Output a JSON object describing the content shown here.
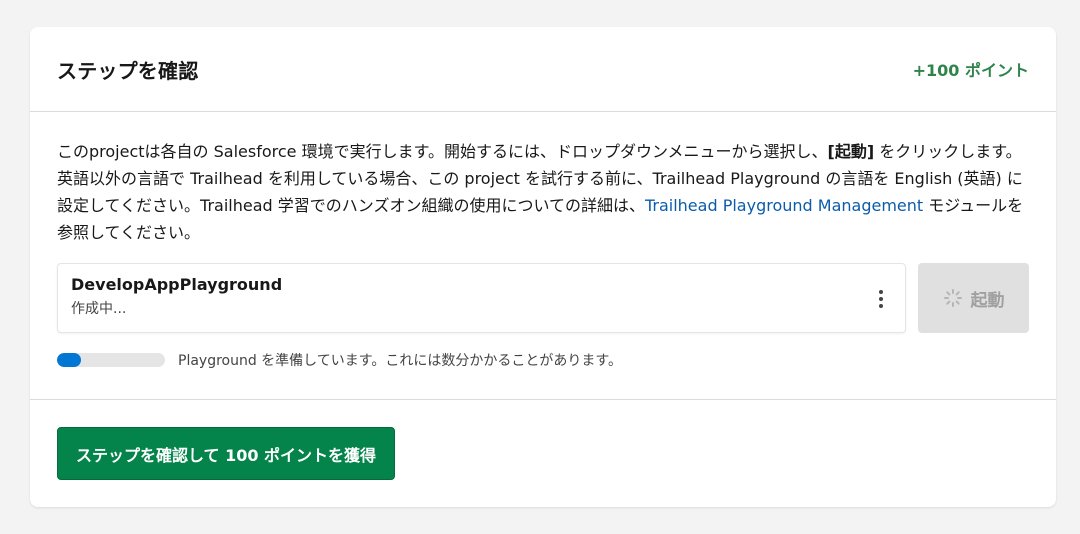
{
  "header": {
    "title": "ステップを確認",
    "points": "+100 ポイント"
  },
  "description": {
    "part1": "このprojectは各自の Salesforce 環境で実行します。開始するには、ドロップダウンメニューから選択し、",
    "bold": "[起動]",
    "part2": " をクリックします。英語以外の言語で Trailhead を利用している場合、この project を試行する前に、Trailhead Playground の言語を English (英語) に設定してください。Trailhead 学習でのハンズオン組織の使用についての詳細は、",
    "link": "Trailhead Playground Management",
    "part3": " モジュールを参照してください。"
  },
  "org": {
    "name": "DevelopAppPlayground",
    "status": "作成中..."
  },
  "launch_button": {
    "label": "起動"
  },
  "progress": {
    "fraction": 0.22,
    "text": "Playground を準備しています。これには数分かかることがあります。"
  },
  "footer": {
    "verify_label": "ステップを確認して 100 ポイントを獲得"
  },
  "colors": {
    "brand_green": "#04844b",
    "points_green": "#2e844a",
    "link_blue": "#0b5cab",
    "progress_blue": "#0176d3"
  }
}
